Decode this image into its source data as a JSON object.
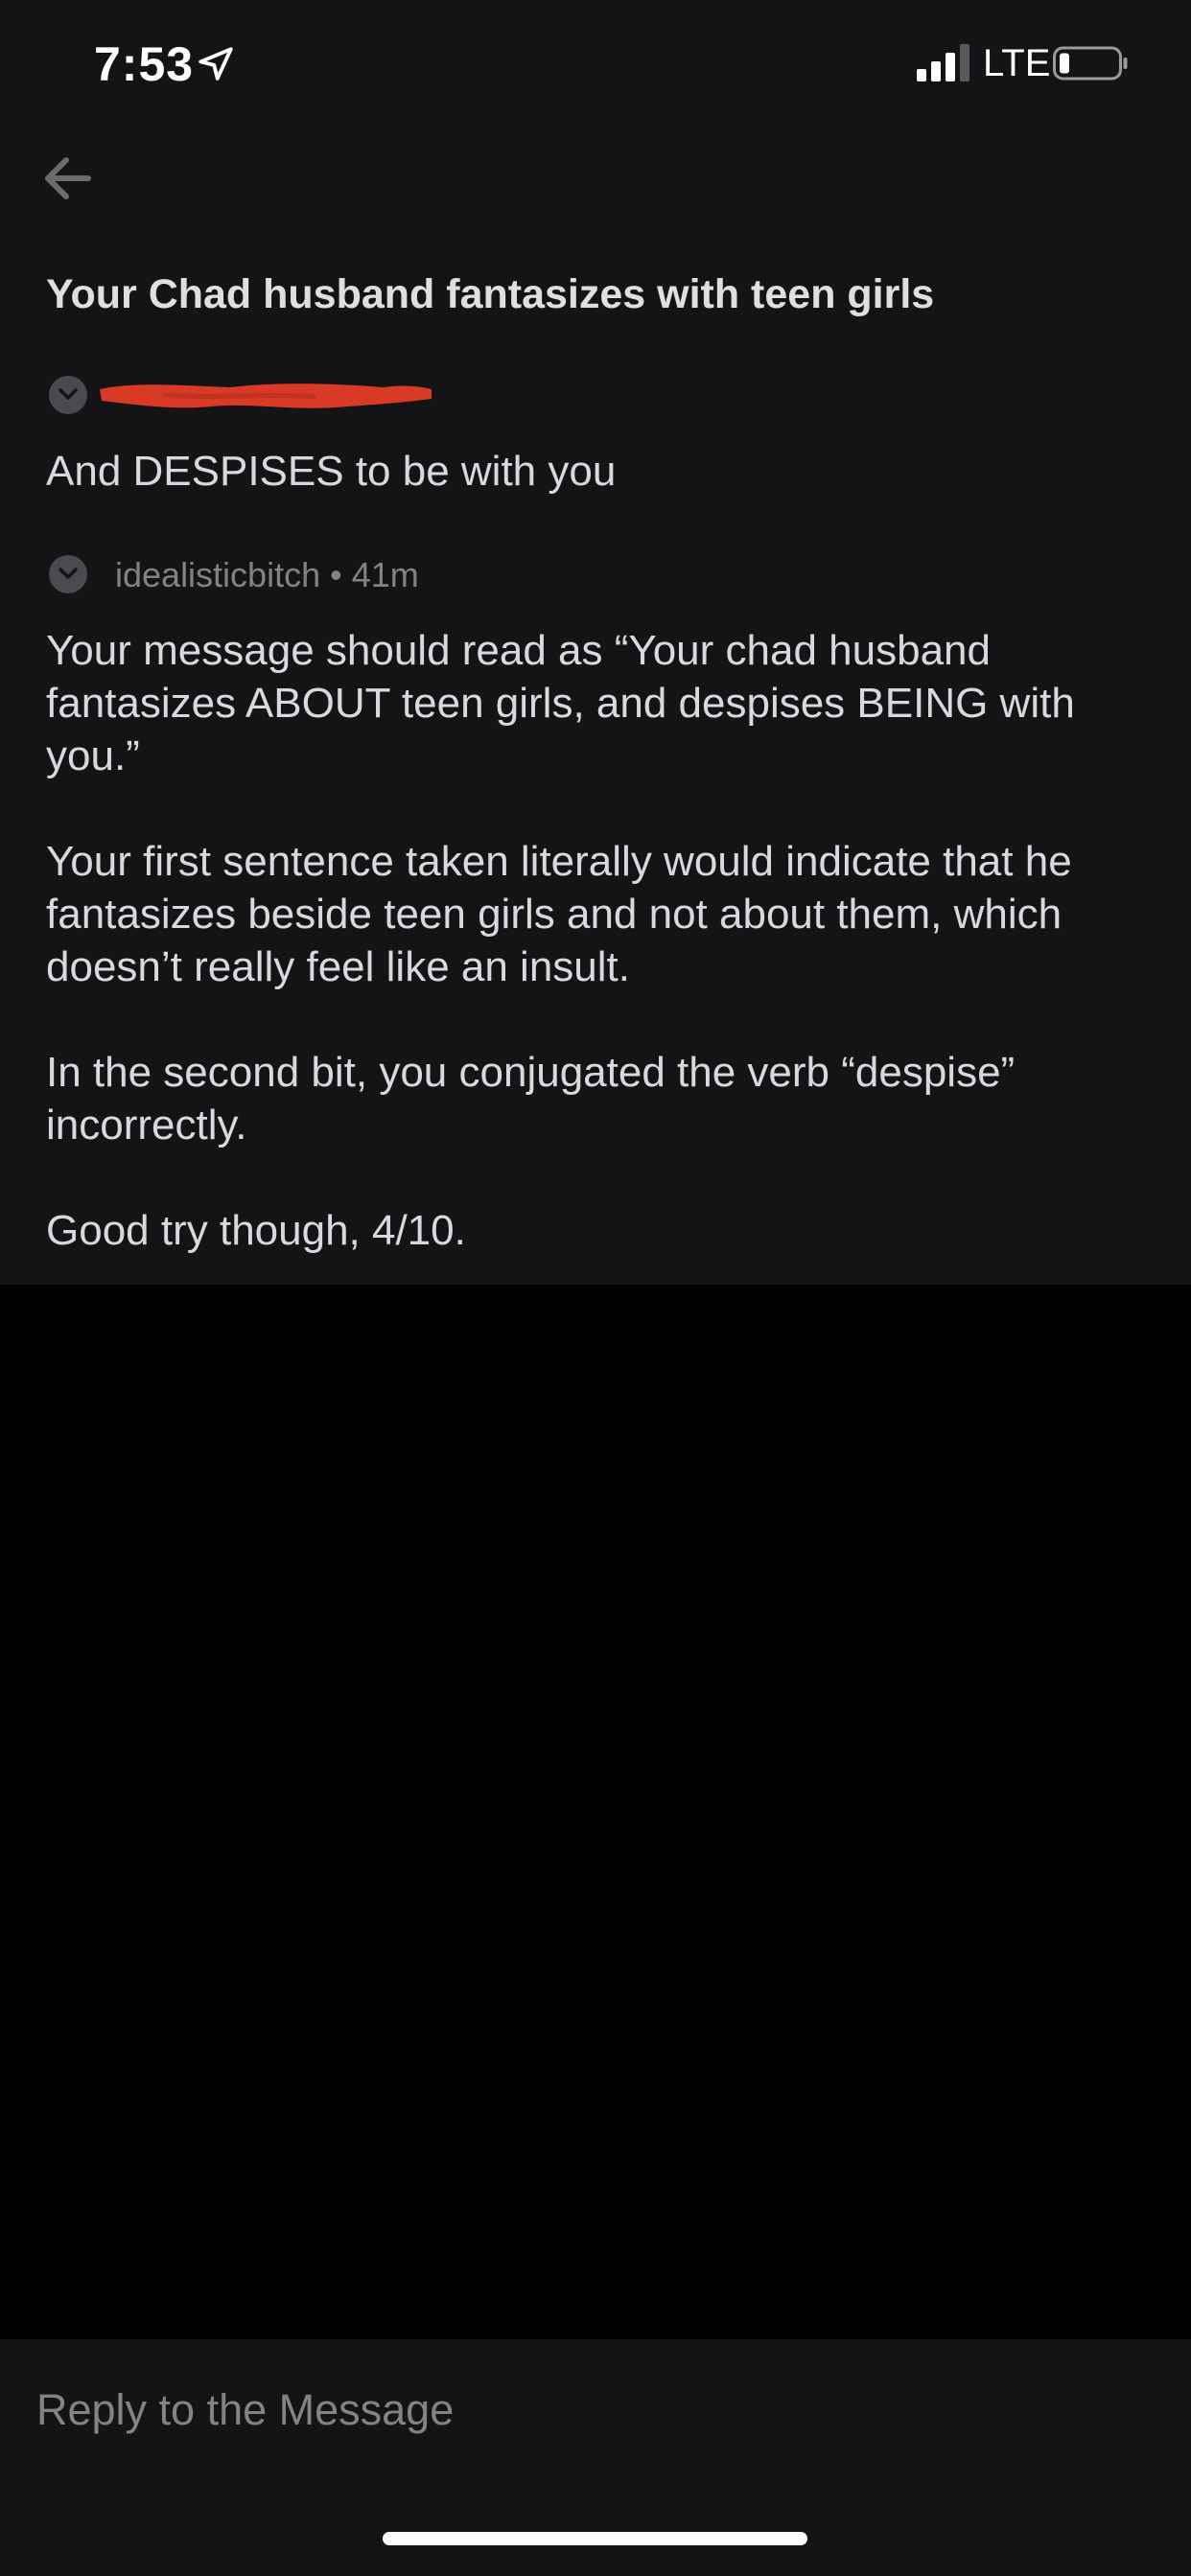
{
  "status_bar": {
    "time": "7:53",
    "network": "LTE",
    "icons": [
      "location-arrow-icon",
      "cellular-signal-icon",
      "battery-icon"
    ]
  },
  "header": {
    "back_icon": "arrow-left-icon"
  },
  "thread": {
    "title": "Your Chad husband fantasizes with teen girls",
    "messages": [
      {
        "author_redacted": true,
        "paragraphs": [
          "And DESPISES to be with you"
        ]
      },
      {
        "author": "idealisticbitch",
        "separator": "•",
        "time_ago": "41m",
        "paragraphs": [
          "Your message should read as “Your chad husband fantasizes ABOUT teen girls, and despises BEING with you.”",
          "Your first sentence taken literally would indicate that he fantasizes beside teen girls and not about them, which doesn’t really feel like an insult.",
          "In the second bit, you conjugated the verb “despise” incorrectly.",
          "Good try though, 4/10."
        ]
      }
    ]
  },
  "reply": {
    "placeholder": "Reply to the Message"
  },
  "colors": {
    "panel_background": "#141416",
    "page_background": "#000000",
    "text_primary": "#d7dadc",
    "text_muted": "#818384",
    "redaction": "#d93a26"
  }
}
